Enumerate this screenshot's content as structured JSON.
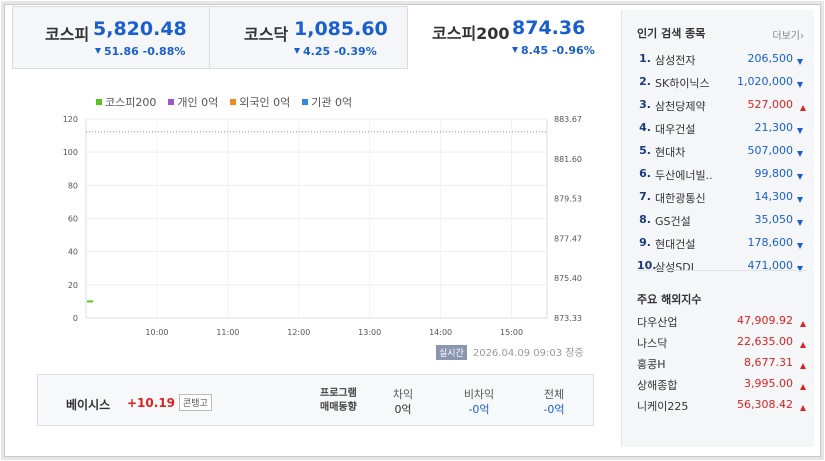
{
  "indices": [
    {
      "name": "코스피",
      "value": "5,820.48",
      "change": "51.86",
      "pct": "-0.88%",
      "direction": "down"
    },
    {
      "name": "코스닥",
      "value": "1,085.60",
      "change": "4.25",
      "pct": "-0.39%",
      "direction": "down"
    },
    {
      "name": "코스피200",
      "value": "874.36",
      "change": "8.45",
      "pct": "-0.96%",
      "direction": "down"
    }
  ],
  "legend": {
    "kospi200": "코스피200",
    "individual": "개인 0억",
    "foreign": "외국인 0억",
    "institution": "기관 0억"
  },
  "colors": {
    "kospi200": "#5cbf2a",
    "individual": "#9b59d0",
    "foreign": "#f08a1c",
    "institution": "#2f8ae6",
    "down": "#1a5fd0",
    "up": "#dd2222"
  },
  "chart_data": {
    "type": "line",
    "x_ticks": [
      "10:00",
      "11:00",
      "12:00",
      "13:00",
      "14:00",
      "15:00"
    ],
    "y_left_ticks": [
      "120",
      "100",
      "80",
      "60",
      "40",
      "20",
      "0"
    ],
    "y_left_range": [
      0,
      120
    ],
    "y_right_ticks": [
      "883.67",
      "881.60",
      "879.53",
      "877.47",
      "875.40",
      "873.33"
    ],
    "y_right_range": [
      873.33,
      883.67
    ],
    "reference_line_value": 883.0,
    "series": [
      {
        "name": "코스피200",
        "values": [
          10,
          10
        ]
      }
    ],
    "grid": true
  },
  "timestamp": {
    "badge": "실시간",
    "time": "2026.04.09 09:03",
    "status": "장중"
  },
  "basis": {
    "label": "베이시스",
    "value": "+10.19",
    "badge": "콘탱고"
  },
  "program": {
    "title_line1": "프로그램",
    "title_line2": "매매동향",
    "columns": [
      {
        "header": "차익",
        "value": "0억",
        "color": "normal"
      },
      {
        "header": "비차익",
        "value": "-0억",
        "color": "blue"
      },
      {
        "header": "전체",
        "value": "-0억",
        "color": "blue"
      }
    ]
  },
  "popular": {
    "title": "인기 검색 종목",
    "more": "더보기",
    "items": [
      {
        "rank": "1.",
        "name": "삼성전자",
        "price": "206,500",
        "direction": "down"
      },
      {
        "rank": "2.",
        "name": "SK하이닉스",
        "price": "1,020,000",
        "direction": "down"
      },
      {
        "rank": "3.",
        "name": "삼천당제약",
        "price": "527,000",
        "direction": "up"
      },
      {
        "rank": "4.",
        "name": "대우건설",
        "price": "21,300",
        "direction": "down"
      },
      {
        "rank": "5.",
        "name": "현대차",
        "price": "507,000",
        "direction": "down"
      },
      {
        "rank": "6.",
        "name": "두산에너빌..",
        "price": "99,800",
        "direction": "down"
      },
      {
        "rank": "7.",
        "name": "대한광통신",
        "price": "14,300",
        "direction": "down"
      },
      {
        "rank": "8.",
        "name": "GS건설",
        "price": "35,050",
        "direction": "down"
      },
      {
        "rank": "9.",
        "name": "현대건설",
        "price": "178,600",
        "direction": "down"
      },
      {
        "rank": "10.",
        "name": "삼성SDI",
        "price": "471,000",
        "direction": "down"
      }
    ]
  },
  "international": {
    "title": "주요 해외지수",
    "items": [
      {
        "name": "다우산업",
        "price": "47,909.92",
        "direction": "up"
      },
      {
        "name": "나스닥",
        "price": "22,635.00",
        "direction": "up"
      },
      {
        "name": "홍콩H",
        "price": "8,677.31",
        "direction": "up"
      },
      {
        "name": "상해종합",
        "price": "3,995.00",
        "direction": "up"
      },
      {
        "name": "니케이225",
        "price": "56,308.42",
        "direction": "up"
      }
    ]
  }
}
